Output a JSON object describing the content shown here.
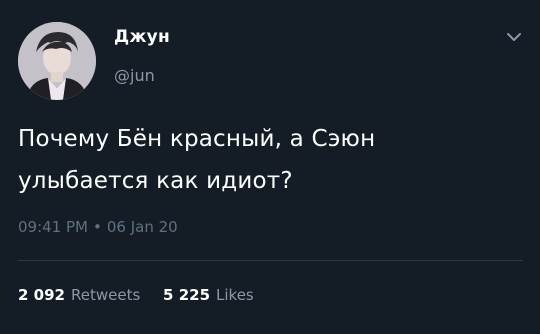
{
  "author": {
    "display_name": "Джун",
    "handle": "@jun"
  },
  "tweet": {
    "text_line1": "Почему Бён красный, а Сэюн",
    "text_line2": "улыбается как идиот?",
    "time": "09:41 PM",
    "separator": "•",
    "date": "06 Jan 20"
  },
  "stats": {
    "retweets_count": "2 092",
    "retweets_label": "Retweets",
    "likes_count": "5 225",
    "likes_label": "Likes"
  },
  "icons": {
    "menu": "chevron-down-icon"
  },
  "colors": {
    "background": "#141d26",
    "text": "#ffffff",
    "secondary": "#8899a6",
    "divider": "#2a3743"
  }
}
